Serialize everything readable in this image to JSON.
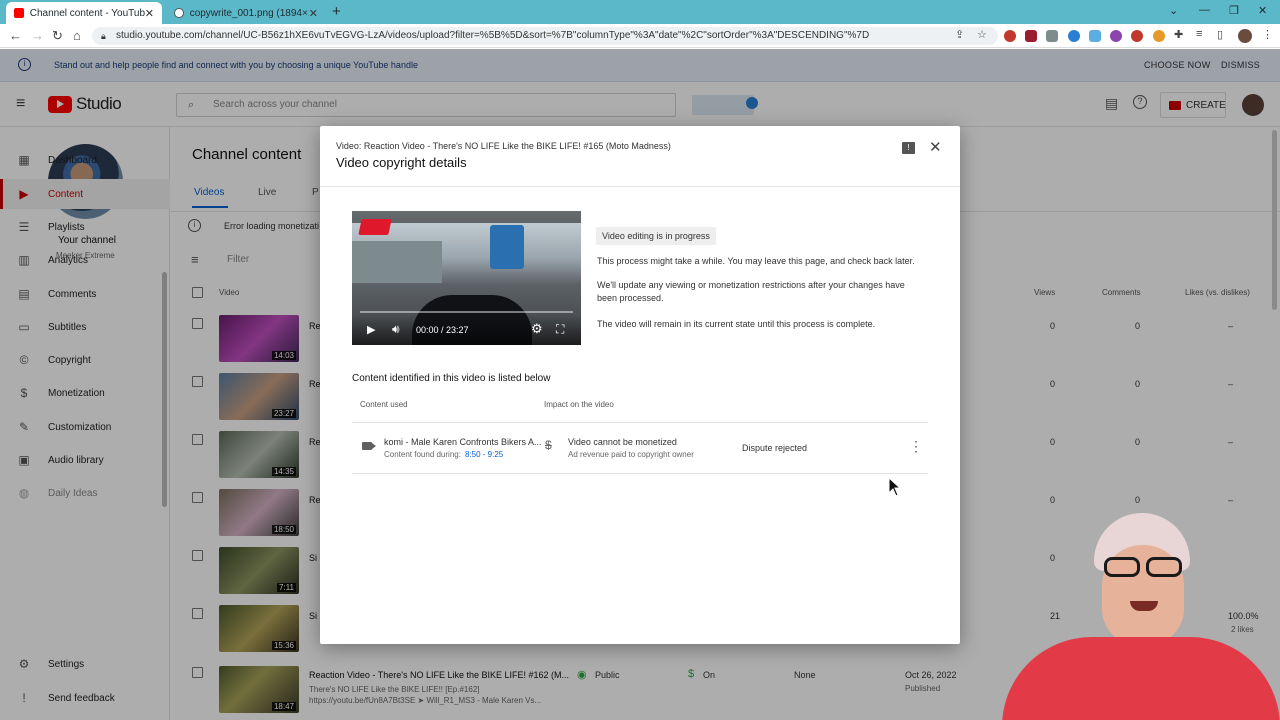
{
  "browser": {
    "tabs": [
      {
        "title": "Channel content - YouTube Studio",
        "active": true
      },
      {
        "title": "copywrite_001.png (1894×1472)",
        "active": false
      }
    ],
    "url": "studio.youtube.com/channel/UC-B56z1hXE6vuTvEGVG-LzA/videos/upload?filter=%5B%5D&sort=%7B\"columnType\"%3A\"date\"%2C\"sortOrder\"%3A\"DESCENDING\"%7D"
  },
  "banner": {
    "text": "Stand out and help people find and connect with you by choosing a unique YouTube handle",
    "choose": "CHOOSE NOW",
    "dismiss": "DISMISS"
  },
  "header": {
    "logo": "Studio",
    "search_placeholder": "Search across your channel",
    "create": "CREATE"
  },
  "sidebar": {
    "your_channel": "Your channel",
    "channel_name": "Meeker Extreme",
    "items": [
      {
        "label": "Dashboard",
        "icon": "dashboard-icon",
        "glyph": "▦"
      },
      {
        "label": "Content",
        "icon": "content-icon",
        "glyph": "▶",
        "active": true
      },
      {
        "label": "Playlists",
        "icon": "playlists-icon",
        "glyph": "☰"
      },
      {
        "label": "Analytics",
        "icon": "analytics-icon",
        "glyph": "▥"
      },
      {
        "label": "Comments",
        "icon": "comments-icon",
        "glyph": "▤"
      },
      {
        "label": "Subtitles",
        "icon": "subtitles-icon",
        "glyph": "▭"
      },
      {
        "label": "Copyright",
        "icon": "copyright-icon",
        "glyph": "©"
      },
      {
        "label": "Monetization",
        "icon": "monetization-icon",
        "glyph": "$"
      },
      {
        "label": "Customization",
        "icon": "customization-icon",
        "glyph": "✎"
      },
      {
        "label": "Audio library",
        "icon": "audio-library-icon",
        "glyph": "▣"
      },
      {
        "label": "Daily Ideas",
        "icon": "daily-ideas-icon",
        "glyph": "◍"
      }
    ],
    "settings": "Settings",
    "feedback": "Send feedback"
  },
  "main": {
    "title": "Channel content",
    "tabs": [
      "Videos",
      "Live",
      "P"
    ],
    "error": "Error loading monetizati",
    "filter": "Filter",
    "col_video": "Video",
    "col_views": "Views",
    "col_comments": "Comments",
    "col_likes": "Likes (vs. dislikes)",
    "rows": [
      {
        "dur": "14:03",
        "title": "Re",
        "views": "0",
        "comments": "0",
        "likes": "–"
      },
      {
        "dur": "23:27",
        "title": "Re",
        "views": "0",
        "comments": "0",
        "likes": "–"
      },
      {
        "dur": "14:35",
        "title": "Re",
        "views": "0",
        "comments": "0",
        "likes": "–"
      },
      {
        "dur": "18:50",
        "title": "Re",
        "views": "0",
        "comments": "0",
        "likes": "–"
      },
      {
        "dur": "7:11",
        "title": "Si",
        "views": "0",
        "comments": "",
        "likes": ""
      },
      {
        "dur": "15:36",
        "title": "Si",
        "views": "21",
        "comments": "",
        "likes": "100.0%",
        "likes_sub": "2 likes"
      }
    ],
    "last_row": {
      "dur": "18:47",
      "title": "Reaction Video - There's NO LIFE Like the BIKE LIFE! #162 (M...",
      "line2": "There's NO LIFE Like the BIKE LIFE!! [Ep.#162]",
      "line3": "https://youtu.be/fUn8A7Bt3SE ➤ Will_R1_MS3 - Male Karen Vs...",
      "visibility": "Public",
      "monetization": "On",
      "restrictions": "None",
      "date": "Oct 26, 2022",
      "date_sub": "Published"
    }
  },
  "modal": {
    "subtitle": "Video: Reaction Video - There's NO LIFE Like the BIKE LIFE! #165 (Moto Madness)",
    "title": "Video copyright details",
    "player_time": "00:00 / 23:27",
    "status_chip": "Video editing is in progress",
    "p1": "This process might take a while. You may leave this page, and check back later.",
    "p2": "We'll update any viewing or monetization restrictions after your changes have been processed.",
    "p3": "The video will remain in its current state until this process is complete.",
    "section_title": "Content identified in this video is listed below",
    "col_content": "Content used",
    "col_impact": "Impact on the video",
    "claim": {
      "title": "komi - Male Karen Confronts Bikers A...",
      "found_label": "Content found during:",
      "found_range": "8:50 - 9:25",
      "impact": "Video cannot be monetized",
      "impact_sub": "Ad revenue paid to copyright owner",
      "status": "Dispute rejected"
    }
  },
  "colors": {
    "accent_red": "#ff0000",
    "link_blue": "#065fd4",
    "tab_bar": "#5bb8c8"
  }
}
